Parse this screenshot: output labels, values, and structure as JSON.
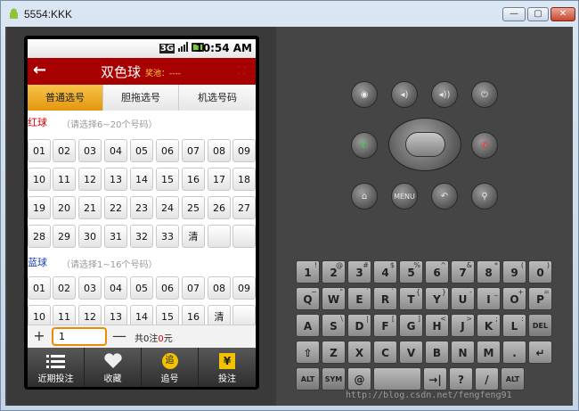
{
  "window": {
    "title": "5554:KKK",
    "min_label": "—",
    "max_label": "▢",
    "close_label": "✕"
  },
  "status": {
    "network": "3G",
    "time": "10:54 AM"
  },
  "app": {
    "back_icon": "←",
    "title": "双色球",
    "pool_label": "奖池：----",
    "expand_icon": "⛶"
  },
  "tabs": [
    {
      "label": "普通选号",
      "active": true
    },
    {
      "label": "胆拖选号",
      "active": false
    },
    {
      "label": "机选号码",
      "active": false
    }
  ],
  "red": {
    "label": "红球",
    "hint": "（请选择6~20个号码）",
    "balls": [
      "01",
      "02",
      "03",
      "04",
      "05",
      "06",
      "07",
      "08",
      "09",
      "10",
      "11",
      "12",
      "13",
      "14",
      "15",
      "16",
      "17",
      "18",
      "19",
      "20",
      "21",
      "22",
      "23",
      "24",
      "25",
      "26",
      "27",
      "28",
      "29",
      "30",
      "31",
      "32",
      "33",
      "清"
    ]
  },
  "blue": {
    "label": "蓝球",
    "hint": "（请选择1~16个号码）",
    "balls": [
      "01",
      "02",
      "03",
      "04",
      "05",
      "06",
      "07",
      "08",
      "09",
      "10",
      "11",
      "12",
      "13",
      "14",
      "15",
      "16",
      "清"
    ]
  },
  "bottom": {
    "plus": "+",
    "minus": "—",
    "quantity": "1",
    "summary_prefix": "共0注",
    "summary_amount": "0",
    "summary_suffix": "元"
  },
  "nav": [
    {
      "label": "近期投注",
      "icon": "list-icon"
    },
    {
      "label": "收藏",
      "icon": "heart-icon"
    },
    {
      "label": "追号",
      "icon": "chase-icon",
      "glyph": "追"
    },
    {
      "label": "投注",
      "icon": "yen-icon",
      "glyph": "¥"
    }
  ],
  "controls": {
    "menu_label": "MENU"
  },
  "keyboard": {
    "rows": [
      [
        [
          "1",
          "!"
        ],
        [
          "2",
          "@"
        ],
        [
          "3",
          "#"
        ],
        [
          "4",
          "$"
        ],
        [
          "5",
          "%"
        ],
        [
          "6",
          "^"
        ],
        [
          "7",
          "&"
        ],
        [
          "8",
          "*"
        ],
        [
          "9",
          "("
        ],
        [
          "0",
          ")"
        ]
      ],
      [
        [
          "Q",
          "~"
        ],
        [
          "W",
          "\""
        ],
        [
          "E",
          "´"
        ],
        [
          "R",
          "`"
        ],
        [
          "T",
          "{"
        ],
        [
          "Y",
          "}"
        ],
        [
          "U",
          "-"
        ],
        [
          "I",
          "_"
        ],
        [
          "O",
          "+"
        ],
        [
          "P",
          "="
        ]
      ],
      [
        [
          "A",
          ""
        ],
        [
          "S",
          "\\"
        ],
        [
          "D",
          "|"
        ],
        [
          "F",
          "["
        ],
        [
          "G",
          "]"
        ],
        [
          "H",
          "<"
        ],
        [
          "J",
          ">"
        ],
        [
          "K",
          ";"
        ],
        [
          "L",
          ":"
        ],
        [
          "DEL",
          ""
        ]
      ],
      [
        [
          "⇧",
          ""
        ],
        [
          "Z",
          ""
        ],
        [
          "X",
          ""
        ],
        [
          "C",
          ""
        ],
        [
          "V",
          ""
        ],
        [
          "B",
          ""
        ],
        [
          "N",
          ""
        ],
        [
          "M",
          ""
        ],
        [
          ".",
          ""
        ],
        [
          "↵",
          ""
        ]
      ],
      [
        [
          "ALT",
          ""
        ],
        [
          "SYM",
          ""
        ],
        [
          "@",
          ""
        ],
        [
          "",
          ""
        ],
        [
          "→|",
          ""
        ],
        [
          "?",
          ""
        ],
        [
          "/",
          ""
        ],
        [
          "ALT",
          ""
        ]
      ]
    ]
  },
  "watermark": "http://blog.csdn.net/fengfeng91"
}
